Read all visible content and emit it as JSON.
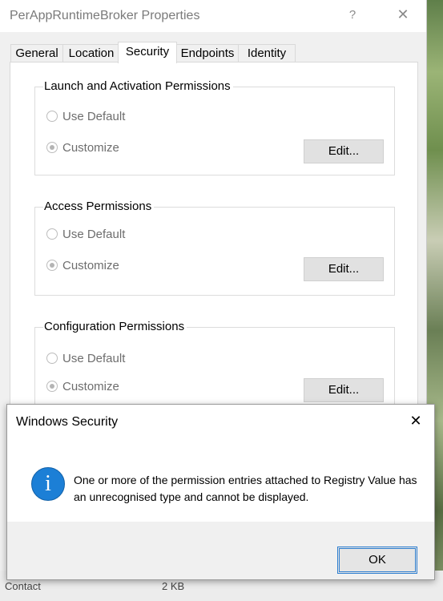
{
  "background": {
    "bottom_left_text": "Contact",
    "bottom_mid_text": "2 KB"
  },
  "properties_dialog": {
    "title": "PerAppRuntimeBroker Properties",
    "help_glyph": "?",
    "close_glyph": "✕",
    "tabs": [
      {
        "label": "General"
      },
      {
        "label": "Location"
      },
      {
        "label": "Security"
      },
      {
        "label": "Endpoints"
      },
      {
        "label": "Identity"
      }
    ],
    "active_tab": "Security",
    "groups": [
      {
        "title": "Launch and Activation Permissions",
        "option_default": "Use Default",
        "option_customize": "Customize",
        "selected": "Customize",
        "edit_label": "Edit..."
      },
      {
        "title": "Access Permissions",
        "option_default": "Use Default",
        "option_customize": "Customize",
        "selected": "Customize",
        "edit_label": "Edit..."
      },
      {
        "title": "Configuration Permissions",
        "option_default": "Use Default",
        "option_customize": "Customize",
        "selected": "Customize",
        "edit_label": "Edit..."
      }
    ]
  },
  "message_box": {
    "title": "Windows Security",
    "close_glyph": "✕",
    "icon": "info-icon",
    "icon_glyph": "i",
    "message_line1": "One or more of the permission entries attached to Registry Value has",
    "message_line2": "an unrecognised type and cannot be displayed.",
    "ok_label": "OK"
  },
  "colors": {
    "info_blue": "#1c7fd6",
    "button_focus": "#2f7fd0"
  }
}
